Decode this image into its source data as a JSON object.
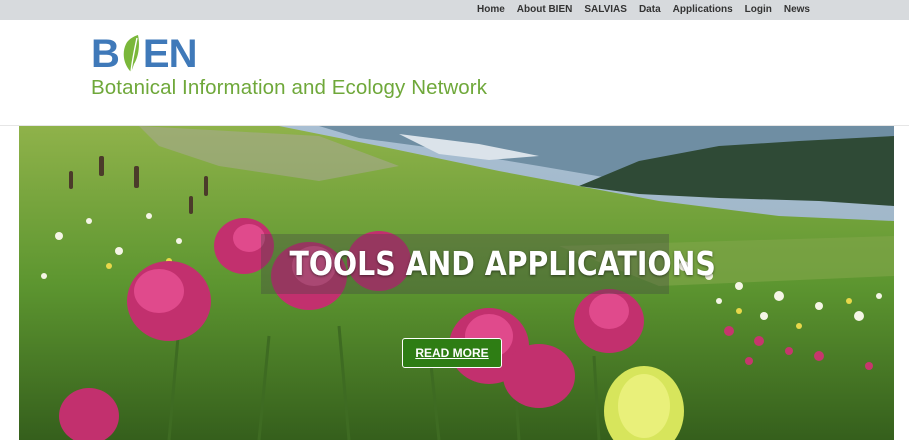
{
  "topnav": {
    "items": [
      {
        "label": "Home"
      },
      {
        "label": "About BIEN"
      },
      {
        "label": "SALVIAS"
      },
      {
        "label": "Data"
      },
      {
        "label": "Applications"
      },
      {
        "label": "Login"
      },
      {
        "label": "News"
      }
    ]
  },
  "header": {
    "logo_letters": {
      "b": "B",
      "en": "EN"
    },
    "logo_text": "BIEN",
    "tagline": "Botanical Information and Ecology Network"
  },
  "hero": {
    "title": "TOOLS AND APPLICATIONS",
    "button_label": "READ MORE"
  },
  "colors": {
    "brand_blue": "#3f79b9",
    "brand_green": "#6fa83a",
    "button_green": "#2e7d14",
    "topbar": "#d7dadd"
  }
}
